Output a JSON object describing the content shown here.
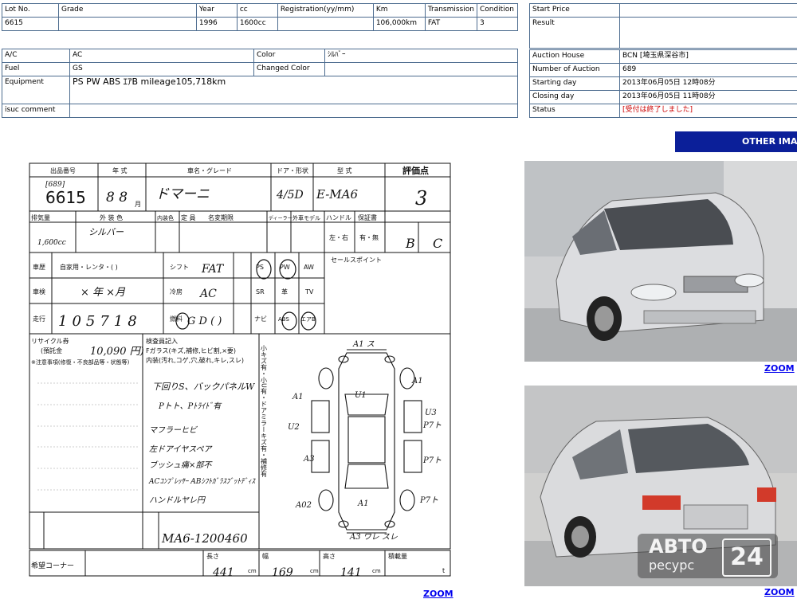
{
  "top_table": {
    "headers": [
      "Lot No.",
      "Grade",
      "Year",
      "cc",
      "Registration(yy/mm)",
      "Km",
      "Transmission",
      "Condition"
    ],
    "values": [
      "6615",
      "",
      "1996",
      "1600cc",
      "",
      "106,000km",
      "FAT",
      "3"
    ]
  },
  "specs": {
    "ac_label": "A/C",
    "ac_value": "AC",
    "color_label": "Color",
    "color_value": "ｼﾙﾊﾞｰ",
    "fuel_label": "Fuel",
    "fuel_value": "GS",
    "changed_color_label": "Changed Color",
    "changed_color_value": "",
    "equipment_label": "Equipment",
    "equipment_value": "PS PW ABS ｴｱB  mileage105,718km",
    "isuc_label": "isuc comment",
    "isuc_value": ""
  },
  "price": {
    "start_label": "Start Price",
    "start_value": "",
    "result_label": "Result",
    "result_value": ""
  },
  "auction": {
    "house_label": "Auction House",
    "house_value": "BCN [埼玉県深谷市]",
    "number_label": "Number of Auction",
    "number_value": "689",
    "start_label": "Starting day",
    "start_value": "2013年06月05日 12時08分",
    "close_label": "Closing day",
    "close_value": "2013年06月05日 11時08分",
    "status_label": "Status",
    "status_value": "[受付は終了しました]"
  },
  "other_images_button": "OTHER IMA",
  "zoom_label": "ZOOM",
  "sheet": {
    "h_lot": "出品番号",
    "h_year": "年 式",
    "h_model": "車名・グレード",
    "h_door": "ドア・形状",
    "h_type": "型 式",
    "h_score": "評価点",
    "v_auction": "[689]",
    "v_lot": "6615",
    "v_year": "8  8",
    "v_month": "月",
    "v_model": "ドマーニ",
    "v_door": "4/5D",
    "v_type": "E-MA6",
    "v_score": "3",
    "h_cc": "排気量",
    "h_color": "外 装 色",
    "h_int": "内装色",
    "h_cap": "定 員",
    "h_period": "名変期限",
    "h_dealer": "ディーラー",
    "h_ext": "外車モデル",
    "h_handle": "ハンドル",
    "h_warranty": "保証書",
    "v_cc": "1,600cc",
    "v_color": "シルバー",
    "v_lr": "左・右",
    "v_yn": "有・無",
    "v_in": "B",
    "v_out": "C",
    "l_history": "車歴",
    "v_history": "自家用・レンタ・(      )",
    "l_shift": "シフト",
    "v_shift": "FAT",
    "l_ps": "PS",
    "l_pw": "PW",
    "l_aw": "AW",
    "l_inspection": "車検",
    "v_inspection": "×  年  ×月",
    "l_cool": "冷房",
    "v_cool": "AC",
    "l_sr": "SR",
    "l_leather": "革",
    "l_tv": "TV",
    "l_mileage": "走行",
    "v_mileage": "105718",
    "l_fuel": "燃料",
    "v_fuel": "G D (    )",
    "l_navi": "ナビ",
    "l_abs": "ABS",
    "l_airbag": "エアB",
    "l_sales": "セールスポイント",
    "l_recycle": "リサイクル券",
    "l_deposit": "(預託金",
    "v_deposit": "10,090 円)",
    "l_notes": "※注意事項(修復・不良部品等・状態等)",
    "l_inspector": "検査員記入",
    "l_glass": "Fガラス(キズ,補修,ヒビ割,×要)",
    "l_interior": "内装(汚れ,コゲ,穴,破れ,キレ,スレ)",
    "notes": [
      "下回りS、バックパネルW",
      "Pトト、Pﾄﾗｲﾄﾞ有",
      "マフラーヒビ",
      "左ドアイヤスペア",
      "ブッシュ痛×部不",
      "ACｺﾝﾌﾟﾚｯｻｰ ABｼﾌﾄｶﾞﾗｽﾌﾞｯﾄﾃﾞｨｽ",
      "ハンドルヤレ円"
    ],
    "v_frame": "MA6-1200460",
    "l_request": "希望コーナー",
    "l_length": "長さ",
    "v_length": "441",
    "l_width": "幅",
    "v_width": "169",
    "l_height": "高さ",
    "v_height": "141",
    "l_load": "積載量",
    "u_cm": "cm",
    "u_t": "t",
    "side_text": "小キズ有・小U有・ドアミラーキズ有・補修有",
    "diagram_marks": [
      "A1 ス",
      "U1",
      "A1",
      "A1",
      "U3",
      "P7ト",
      "A3",
      "U2",
      "P7ト",
      "A02",
      "A1",
      "P7ト",
      "A3 ワレ スレ"
    ]
  },
  "watermark": {
    "line1": "АВТО",
    "line2": "ресурс",
    "num": "24"
  }
}
